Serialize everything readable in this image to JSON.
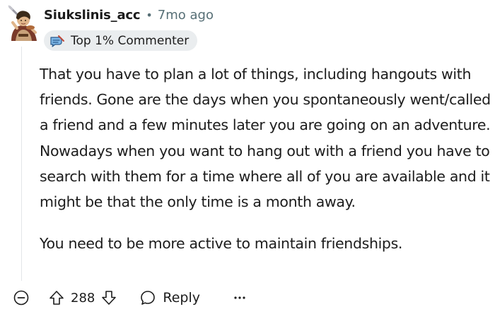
{
  "comment": {
    "author": "Siukslinis_acc",
    "separator": "•",
    "age": "7mo ago",
    "flair": {
      "icon": "commenter-badge-icon",
      "label": "Top 1% Commenter"
    },
    "paragraphs": [
      "That you have to plan a lot of things, including hangouts with friends. Gone are the days when you spontaneously went/called a friend and a few minutes later you are going on an adventure. Nowadays when you want to hang out with a friend you have to search with them for a time where all of you are available and it might be that the only time is a month away.",
      "You need to be more active to maintain friendships."
    ]
  },
  "actions": {
    "collapse_icon": "collapse-icon",
    "upvote_icon": "upvote-arrow-icon",
    "score": "288",
    "downvote_icon": "downvote-arrow-icon",
    "reply_icon": "speech-bubble-icon",
    "reply_label": "Reply",
    "more_label": "···"
  },
  "colors": {
    "text": "#1c1c1c",
    "meta": "#576f76",
    "flair_bg": "#eaedef",
    "thread_line": "#e3e5e8"
  }
}
